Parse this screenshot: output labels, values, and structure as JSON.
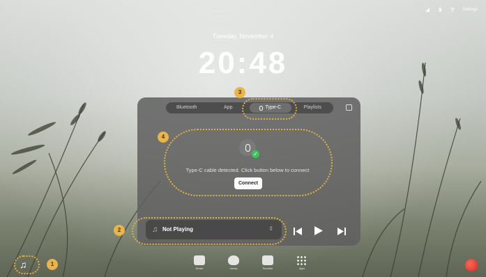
{
  "status_bar": {
    "settings_label": "Settings",
    "icons": [
      "signal-icon",
      "bluetooth-icon",
      "wifi-icon"
    ]
  },
  "lock": {
    "date": "Tuesday, November 4",
    "time": "20:48"
  },
  "panel": {
    "tabs": [
      {
        "label": "Bluetooth",
        "active": false
      },
      {
        "label": "App",
        "active": false
      },
      {
        "label": "Type-C",
        "active": true
      },
      {
        "label": "Playlists",
        "active": false
      }
    ],
    "message": "Type-C cable detected. Click button below to connect",
    "connect_label": "Connect"
  },
  "player": {
    "title": "Not Playing",
    "note_icon": "♫"
  },
  "callouts": [
    "1",
    "2",
    "3",
    "4"
  ],
  "dock": [
    {
      "label": "Device",
      "icon": "device-icon"
    },
    {
      "label": "Library",
      "icon": "flame-icon"
    },
    {
      "label": "Recorder",
      "icon": "recorder-icon"
    },
    {
      "label": "Apps",
      "icon": "grid-icon"
    }
  ],
  "colors": {
    "callout": "#e3b33f",
    "badge": "#e9b54a",
    "success": "#3cc35a",
    "record": "#d5281c"
  }
}
